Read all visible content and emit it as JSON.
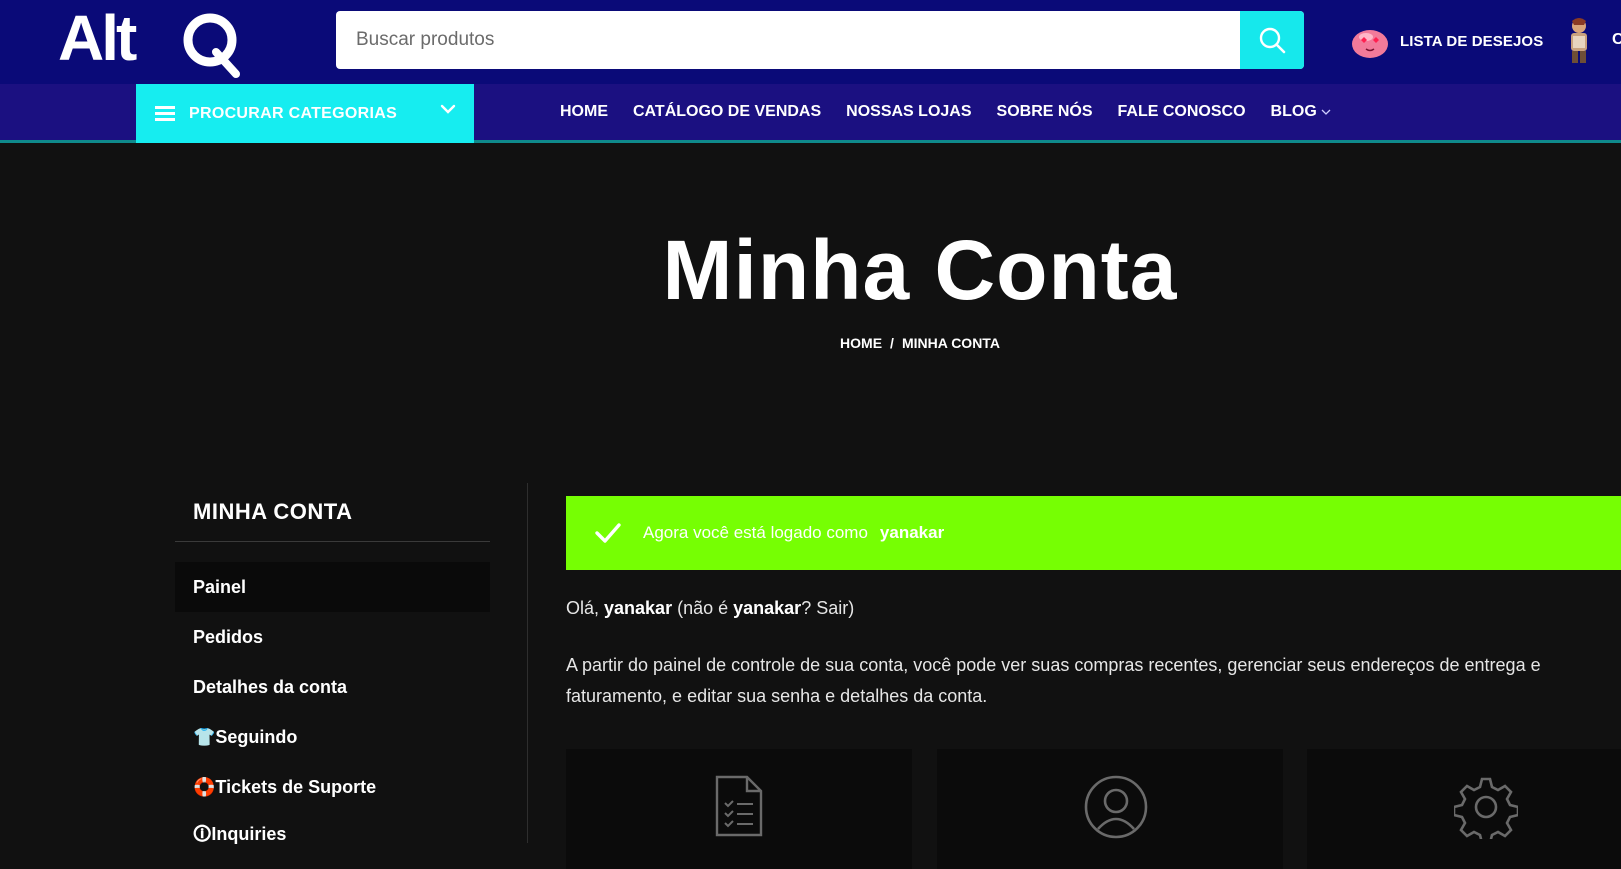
{
  "header": {
    "logo_text": "AltQ",
    "search": {
      "placeholder": "Buscar produtos",
      "value": ""
    },
    "wishlist_label": "LISTA DE DESEJOS",
    "cut_letter": "C"
  },
  "nav": {
    "categories_label": "PROCURAR CATEGORIAS",
    "links": [
      "HOME",
      "CATÁLOGO DE VENDAS",
      "NOSSAS LOJAS",
      "SOBRE NÓS",
      "FALE CONOSCO",
      "BLOG"
    ]
  },
  "hero": {
    "title": "Minha Conta",
    "breadcrumb": [
      "HOME",
      "/",
      "MINHA CONTA"
    ]
  },
  "sidebar": {
    "title": "MINHA CONTA",
    "items": [
      {
        "label": "Painel",
        "active": true
      },
      {
        "label": "Pedidos"
      },
      {
        "label": "Detalhes da conta"
      },
      {
        "label": "👕Seguindo"
      },
      {
        "label": "🛟Tickets de Suporte"
      },
      {
        "label": "🛈Inquiries"
      }
    ]
  },
  "notice": {
    "text": "Agora você está logado como",
    "user": "yanakar"
  },
  "content": {
    "hello_prefix": "Olá, ",
    "hello_user": "yanakar",
    "hello_middle": " (não é ",
    "hello_user2": "yanakar",
    "hello_suffix": "? ",
    "logout": "Sair",
    "hello_close": ")",
    "description": "A partir do painel de controle de sua conta, você pode ver suas compras recentes, gerenciar seus endereços de entrega e faturamento, e editar sua senha e detalhes da conta."
  },
  "cards": [
    {
      "icon": "orders-document-icon"
    },
    {
      "icon": "user-profile-icon"
    },
    {
      "icon": "settings-gear-icon"
    }
  ],
  "colors": {
    "topbar": "#0a0a78",
    "navbar": "#1b1081",
    "accent_cyan": "#16edf0",
    "success_green": "#76ff03",
    "page_bg": "#111111"
  }
}
